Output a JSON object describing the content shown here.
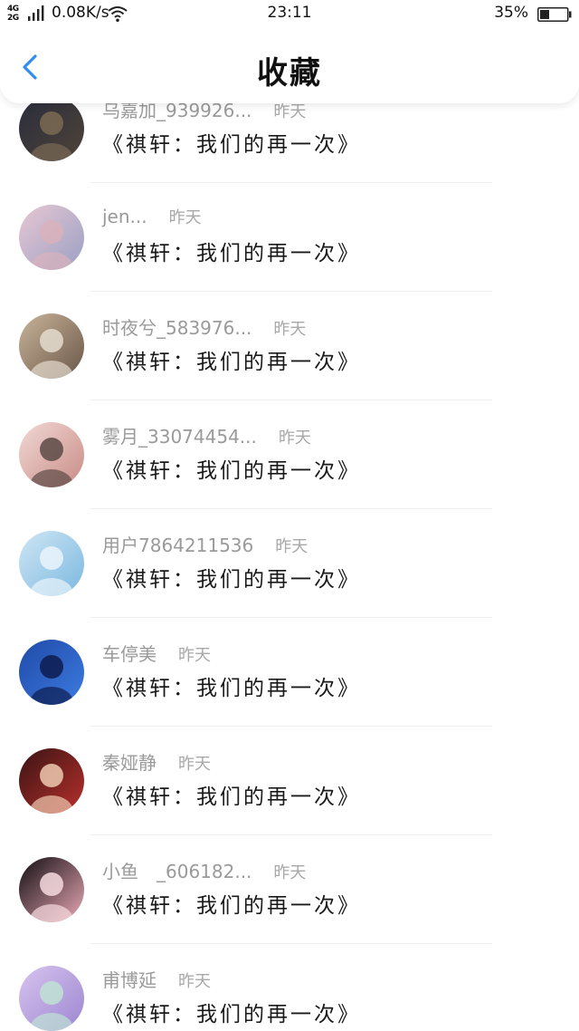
{
  "status_bar": {
    "net_type_top": "4G",
    "net_type_bottom": "2G",
    "net_speed": "0.08K/s",
    "time": "23:11",
    "battery_percent": "35%",
    "battery_level": 0.35,
    "icons": [
      "signal-icon",
      "wifi-icon",
      "battery-icon"
    ]
  },
  "header": {
    "title": "收藏",
    "back_icon": "chevron-left-icon",
    "accent_color": "#2f8ff0"
  },
  "items": [
    {
      "user": "乌嘉加_939926...",
      "time": "昨天",
      "title": "《祺轩：我们的再一次》",
      "avatar_colors": [
        "#2a2d3d",
        "#4e4338",
        "#7b6a55"
      ]
    },
    {
      "user": "jen...",
      "time": "昨天",
      "title": "《祺轩：我们的再一次》",
      "avatar_colors": [
        "#e8c7d3",
        "#9aa0c4",
        "#d9b2bc"
      ]
    },
    {
      "user": "时夜兮_583976...",
      "time": "昨天",
      "title": "《祺轩：我们的再一次》",
      "avatar_colors": [
        "#c9b49a",
        "#6a5648",
        "#e4dccf"
      ]
    },
    {
      "user": "雾月_33074454...",
      "time": "昨天",
      "title": "《祺轩：我们的再一次》",
      "avatar_colors": [
        "#f1d9d5",
        "#c98b86",
        "#5c4a46"
      ]
    },
    {
      "user": "用户7864211536",
      "time": "昨天",
      "title": "《祺轩：我们的再一次》",
      "avatar_colors": [
        "#cfe6f5",
        "#7bb8df",
        "#eaf4fb"
      ]
    },
    {
      "user": "车停美",
      "time": "昨天",
      "title": "《祺轩：我们的再一次》",
      "avatar_colors": [
        "#1f4aa8",
        "#3d7be0",
        "#0d1c4f"
      ]
    },
    {
      "user": "秦娅静",
      "time": "昨天",
      "title": "《祺轩：我们的再一次》",
      "avatar_colors": [
        "#3a1414",
        "#b7302c",
        "#efc9b0"
      ]
    },
    {
      "user": "小鱼　_606182...",
      "time": "昨天",
      "title": "《祺轩：我们的再一次》",
      "avatar_colors": [
        "#120d12",
        "#e9a9b5",
        "#f6dbe0"
      ]
    },
    {
      "user": "甫博延",
      "time": "昨天",
      "title": "《祺轩：我们的再一次》",
      "avatar_colors": [
        "#d7c4ef",
        "#9d86d1",
        "#bfe3d4"
      ]
    }
  ]
}
